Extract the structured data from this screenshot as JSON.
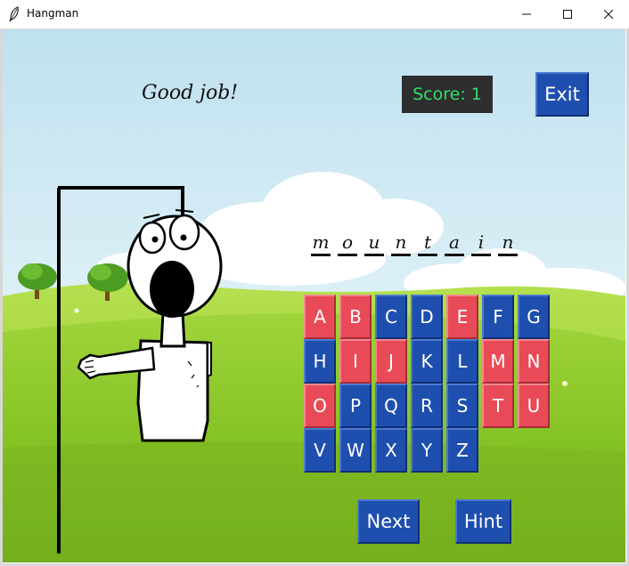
{
  "window": {
    "title": "Hangman"
  },
  "game": {
    "message": "Good job!",
    "score_label": "Score: 1",
    "exit_label": "Exit",
    "next_label": "Next",
    "hint_label": "Hint",
    "word": [
      "m",
      "o",
      "u",
      "n",
      "t",
      "a",
      "i",
      "n"
    ],
    "keyboard": [
      {
        "letter": "A",
        "state": "wrong"
      },
      {
        "letter": "B",
        "state": "wrong"
      },
      {
        "letter": "C",
        "state": "available"
      },
      {
        "letter": "D",
        "state": "available"
      },
      {
        "letter": "E",
        "state": "wrong"
      },
      {
        "letter": "F",
        "state": "available"
      },
      {
        "letter": "G",
        "state": "available"
      },
      {
        "letter": "H",
        "state": "available"
      },
      {
        "letter": "I",
        "state": "wrong"
      },
      {
        "letter": "J",
        "state": "wrong"
      },
      {
        "letter": "K",
        "state": "available"
      },
      {
        "letter": "L",
        "state": "available"
      },
      {
        "letter": "M",
        "state": "wrong"
      },
      {
        "letter": "N",
        "state": "wrong"
      },
      {
        "letter": "O",
        "state": "wrong"
      },
      {
        "letter": "P",
        "state": "available"
      },
      {
        "letter": "Q",
        "state": "available"
      },
      {
        "letter": "R",
        "state": "available"
      },
      {
        "letter": "S",
        "state": "available"
      },
      {
        "letter": "T",
        "state": "wrong"
      },
      {
        "letter": "U",
        "state": "wrong"
      },
      {
        "letter": "V",
        "state": "available"
      },
      {
        "letter": "W",
        "state": "available"
      },
      {
        "letter": "X",
        "state": "available"
      },
      {
        "letter": "Y",
        "state": "available"
      },
      {
        "letter": "Z",
        "state": "available"
      }
    ]
  },
  "colors": {
    "key_available": "#1f4fae",
    "key_used": "#e84b57",
    "score_text": "#2ee06a",
    "score_bg": "#2e2e2e"
  }
}
